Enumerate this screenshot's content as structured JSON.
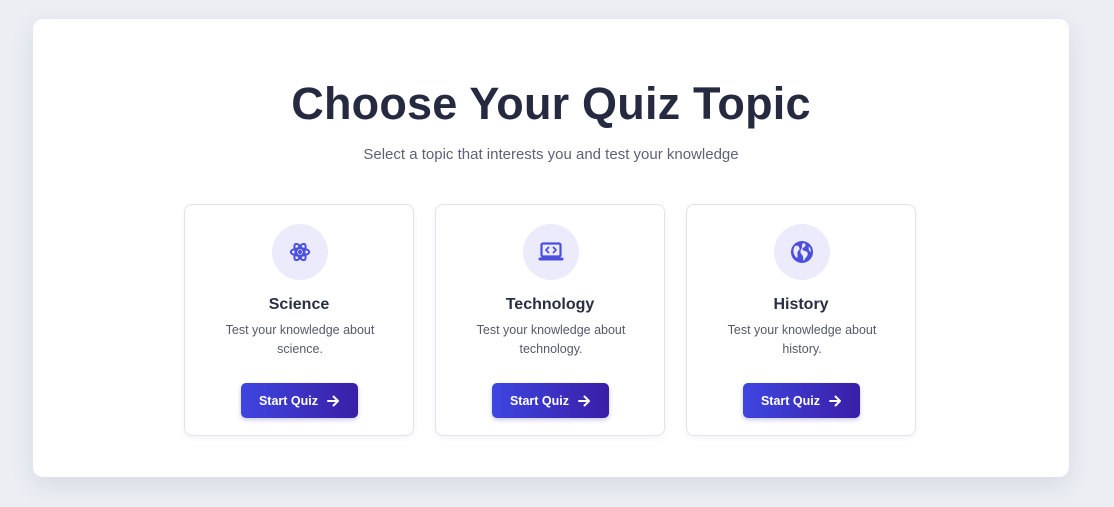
{
  "page": {
    "title": "Choose Your Quiz Topic",
    "subtitle": "Select a topic that interests you and test your knowledge"
  },
  "topics": [
    {
      "name": "Science",
      "description": "Test your knowledge about science.",
      "icon": "atom-icon",
      "button_label": "Start Quiz"
    },
    {
      "name": "Technology",
      "description": "Test your knowledge about technology.",
      "icon": "laptop-code-icon",
      "button_label": "Start Quiz"
    },
    {
      "name": "History",
      "description": "Test your knowledge about history.",
      "icon": "globe-icon",
      "button_label": "Start Quiz"
    }
  ],
  "colors": {
    "accent": "#4a4fe0",
    "button_gradient_start": "#3e46e0",
    "button_gradient_end": "#3a1ea6",
    "icon_bg": "#ecebfb",
    "title": "#252a40"
  }
}
